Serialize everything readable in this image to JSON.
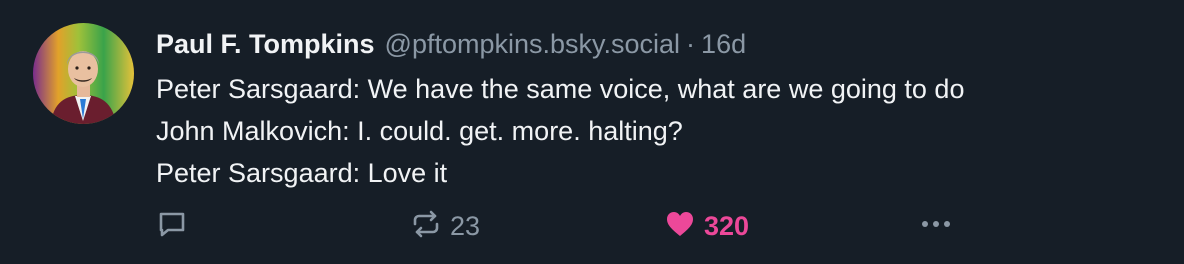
{
  "post": {
    "author_name": "Paul F. Tompkins",
    "author_handle": "@pftompkins.bsky.social",
    "separator": "·",
    "timestamp": "16d",
    "text_lines": [
      "Peter Sarsgaard: We have the same voice, what are we going to do",
      "John Malkovich: I. could. get. more. halting?",
      "Peter Sarsgaard: Love it"
    ],
    "actions": {
      "reply_icon": "speech-bubble-icon",
      "repost_icon": "repost-arrows-icon",
      "repost_count": "23",
      "like_icon": "heart-icon",
      "like_count": "320",
      "like_active": true,
      "more_icon": "ellipsis-icon"
    }
  },
  "colors": {
    "background": "#161e27",
    "text": "#f1f3f5",
    "muted": "#8b98a5",
    "like_accent": "#ec4899"
  }
}
